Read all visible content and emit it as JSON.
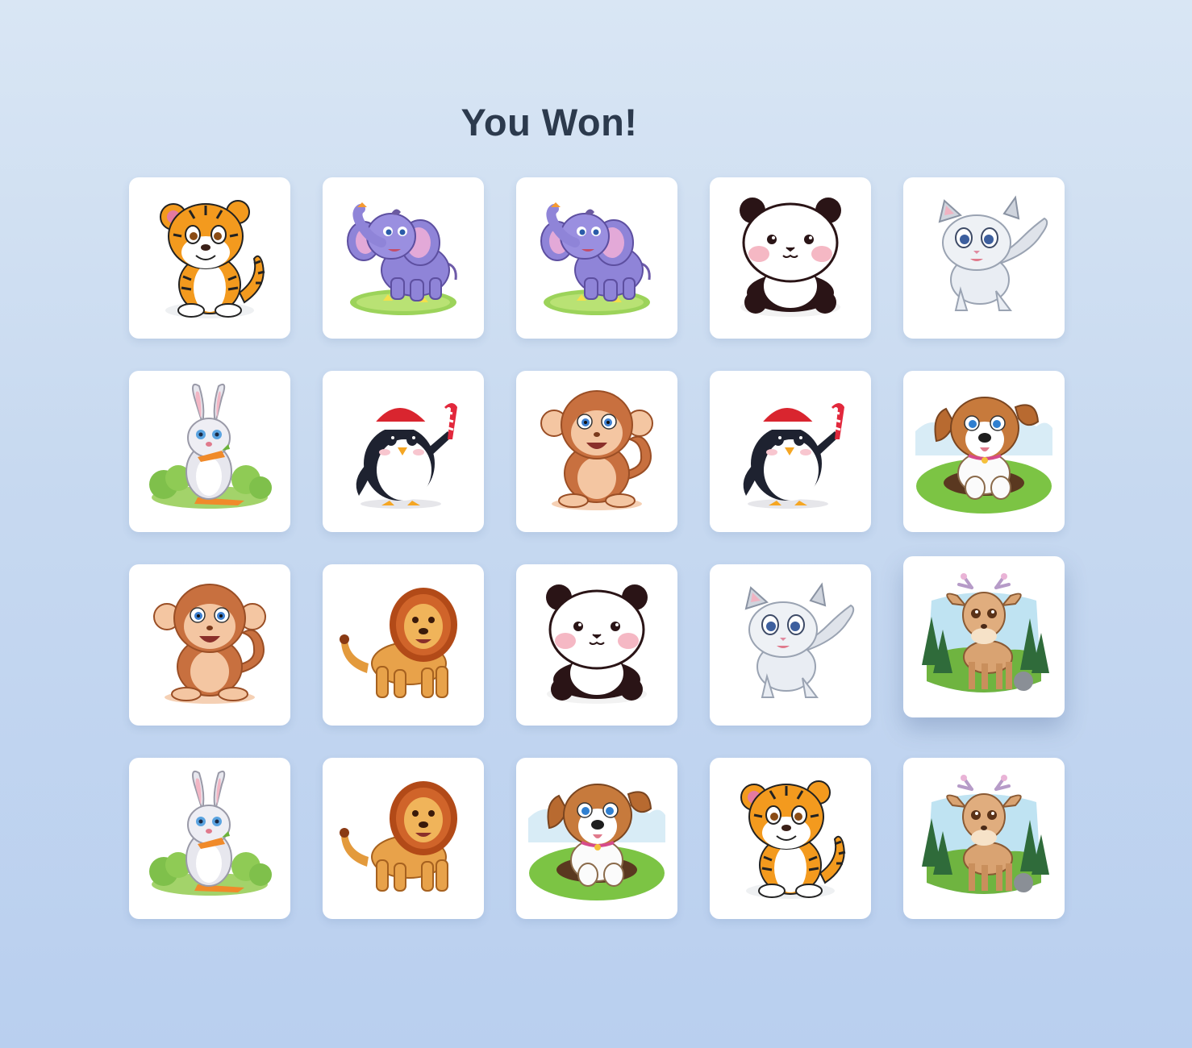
{
  "title": "You Won!",
  "cards": [
    {
      "animal": "tiger",
      "icon": "tiger-icon"
    },
    {
      "animal": "elephant",
      "icon": "elephant-icon"
    },
    {
      "animal": "elephant",
      "icon": "elephant-icon"
    },
    {
      "animal": "panda",
      "icon": "panda-icon"
    },
    {
      "animal": "cat",
      "icon": "cat-icon"
    },
    {
      "animal": "rabbit",
      "icon": "rabbit-icon"
    },
    {
      "animal": "penguin",
      "icon": "penguin-icon"
    },
    {
      "animal": "monkey",
      "icon": "monkey-icon"
    },
    {
      "animal": "penguin",
      "icon": "penguin-icon"
    },
    {
      "animal": "dog",
      "icon": "dog-icon"
    },
    {
      "animal": "monkey",
      "icon": "monkey-icon"
    },
    {
      "animal": "lion",
      "icon": "lion-icon"
    },
    {
      "animal": "panda",
      "icon": "panda-icon"
    },
    {
      "animal": "cat",
      "icon": "cat-icon"
    },
    {
      "animal": "deer",
      "icon": "deer-icon",
      "hovered": true
    },
    {
      "animal": "rabbit",
      "icon": "rabbit-icon"
    },
    {
      "animal": "lion",
      "icon": "lion-icon"
    },
    {
      "animal": "dog",
      "icon": "dog-icon"
    },
    {
      "animal": "tiger",
      "icon": "tiger-icon"
    },
    {
      "animal": "deer",
      "icon": "deer-icon"
    }
  ],
  "colors": {
    "title": "#2c3a4d",
    "card_bg": "#ffffff"
  }
}
